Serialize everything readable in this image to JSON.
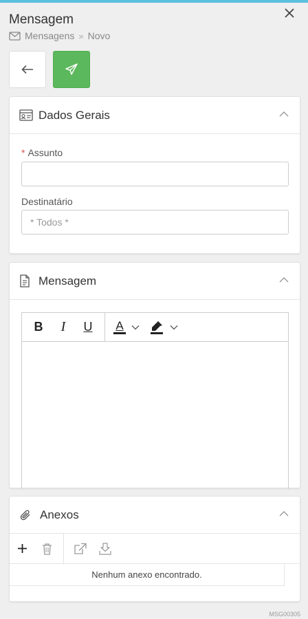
{
  "header": {
    "title": "Mensagem",
    "breadcrumb": [
      "Mensagens",
      "Novo"
    ]
  },
  "actions": {
    "back_icon": "arrow-left-icon",
    "send_icon": "paper-plane-icon",
    "send_color": "#5cb85c"
  },
  "general": {
    "title": "Dados Gerais",
    "subject_label": "Assunto",
    "subject_value": "",
    "recipient_label": "Destinatário",
    "recipient_placeholder": "* Todos *"
  },
  "message": {
    "title": "Mensagem",
    "toolbar": {
      "bold": "B",
      "italic": "I",
      "underline": "U",
      "font_color": "A"
    }
  },
  "attachments": {
    "title": "Anexos",
    "empty_text": "Nenhum anexo encontrado."
  },
  "footer": {
    "code": "MSG00305"
  },
  "colors": {
    "accent": "#5bc0de",
    "required": "#d9534f"
  }
}
